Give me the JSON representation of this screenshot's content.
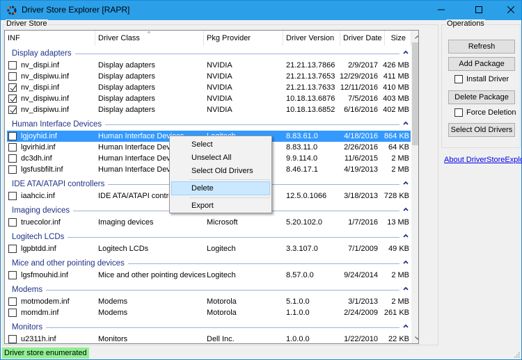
{
  "window": {
    "title": "Driver Store Explorer [RAPR]",
    "icon": "gear-icon",
    "controls": {
      "minimize": "minimize-icon",
      "maximize": "maximize-icon",
      "close": "close-icon"
    }
  },
  "driver_store": {
    "group_label": "Driver Store",
    "columns": [
      {
        "key": "inf",
        "label": "INF"
      },
      {
        "key": "class",
        "label": "Driver Class",
        "sorted": "ascending"
      },
      {
        "key": "provider",
        "label": "Pkg Provider"
      },
      {
        "key": "version",
        "label": "Driver Version"
      },
      {
        "key": "date",
        "label": "Driver Date"
      },
      {
        "key": "size",
        "label": "Size"
      }
    ],
    "groups": [
      {
        "title": "Display adapters",
        "rows": [
          {
            "checked": false,
            "selected": false,
            "inf": "nv_dispi.inf",
            "class": "Display adapters",
            "provider": "NVIDIA",
            "version": "21.21.13.7866",
            "date": "2/9/2017",
            "size": "426 MB"
          },
          {
            "checked": false,
            "selected": false,
            "inf": "nv_dispiwu.inf",
            "class": "Display adapters",
            "provider": "NVIDIA",
            "version": "21.21.13.7653",
            "date": "12/29/2016",
            "size": "411 MB"
          },
          {
            "checked": true,
            "selected": false,
            "inf": "nv_dispi.inf",
            "class": "Display adapters",
            "provider": "NVIDIA",
            "version": "21.21.13.7633",
            "date": "12/11/2016",
            "size": "410 MB"
          },
          {
            "checked": true,
            "selected": false,
            "inf": "nv_dispiwu.inf",
            "class": "Display adapters",
            "provider": "NVIDIA",
            "version": "10.18.13.6876",
            "date": "7/5/2016",
            "size": "403 MB"
          },
          {
            "checked": true,
            "selected": false,
            "inf": "nv_dispiwu.inf",
            "class": "Display adapters",
            "provider": "NVIDIA",
            "version": "10.18.13.6852",
            "date": "6/16/2016",
            "size": "402 MB"
          }
        ]
      },
      {
        "title": "Human Interface Devices",
        "rows": [
          {
            "checked": false,
            "selected": true,
            "inf": "lgjoyhid.inf",
            "class": "Human Interface Devices",
            "provider": "Logitech",
            "version": "8.83.61.0",
            "date": "4/18/2016",
            "size": "864 KB"
          },
          {
            "checked": false,
            "selected": false,
            "inf": "lgvirhid.inf",
            "class": "Human Interface Devices",
            "provider": "",
            "version": "8.83.11.0",
            "date": "2/26/2016",
            "size": "64 KB"
          },
          {
            "checked": false,
            "selected": false,
            "inf": "dc3dh.inf",
            "class": "Human Interface Devices",
            "provider": "",
            "version": "9.9.114.0",
            "date": "11/6/2015",
            "size": "2 MB"
          },
          {
            "checked": false,
            "selected": false,
            "inf": "lgsfusbfilt.inf",
            "class": "Human Interface Devices",
            "provider": "",
            "version": "8.46.17.1",
            "date": "4/19/2013",
            "size": "2 MB"
          }
        ]
      },
      {
        "title": "IDE ATA/ATAPI controllers",
        "rows": [
          {
            "checked": false,
            "selected": false,
            "inf": "iaahcic.inf",
            "class": "IDE ATA/ATAPI controllers",
            "provider": "",
            "version": "12.5.0.1066",
            "date": "3/18/2013",
            "size": "728 KB"
          }
        ]
      },
      {
        "title": "Imaging devices",
        "rows": [
          {
            "checked": false,
            "selected": false,
            "inf": "truecolor.inf",
            "class": "Imaging devices",
            "provider": "Microsoft",
            "version": "5.20.102.0",
            "date": "1/7/2016",
            "size": "13 MB"
          }
        ]
      },
      {
        "title": "Logitech LCDs",
        "rows": [
          {
            "checked": false,
            "selected": false,
            "inf": "lgpbtdd.inf",
            "class": "Logitech LCDs",
            "provider": "Logitech",
            "version": "3.3.107.0",
            "date": "7/1/2009",
            "size": "49 KB"
          }
        ]
      },
      {
        "title": "Mice and other pointing devices",
        "rows": [
          {
            "checked": false,
            "selected": false,
            "inf": "lgsfmouhid.inf",
            "class": "Mice and other pointing devices",
            "provider": "Logitech",
            "version": "8.57.0.0",
            "date": "9/24/2014",
            "size": "2 MB"
          }
        ]
      },
      {
        "title": "Modems",
        "rows": [
          {
            "checked": false,
            "selected": false,
            "inf": "motmodem.inf",
            "class": "Modems",
            "provider": "Motorola",
            "version": "5.1.0.0",
            "date": "3/1/2013",
            "size": "2 MB"
          },
          {
            "checked": false,
            "selected": false,
            "inf": "momdm.inf",
            "class": "Modems",
            "provider": "Motorola",
            "version": "1.1.0.0",
            "date": "2/24/2009",
            "size": "261 KB"
          }
        ]
      },
      {
        "title": "Monitors",
        "rows": [
          {
            "checked": false,
            "selected": false,
            "inf": "u2311h.inf",
            "class": "Monitors",
            "provider": "Dell Inc.",
            "version": "1.0.0.0",
            "date": "1/22/2010",
            "size": "22 KB"
          }
        ]
      }
    ]
  },
  "operations": {
    "group_label": "Operations",
    "refresh_label": "Refresh",
    "add_package_label": "Add Package",
    "install_driver_label": "Install Driver",
    "install_driver_checked": false,
    "delete_package_label": "Delete Package",
    "force_deletion_label": "Force Deletion",
    "force_deletion_checked": false,
    "select_old_drivers_label": "Select Old Drivers",
    "about_link": "About DriverStoreExplorer"
  },
  "context_menu": {
    "items": [
      {
        "label": "Select",
        "highlighted": false
      },
      {
        "label": "Unselect All",
        "highlighted": false
      },
      {
        "label": "Select Old Drivers",
        "highlighted": false
      },
      {
        "label": "Delete",
        "highlighted": true
      },
      {
        "label": "Export",
        "highlighted": false
      }
    ]
  },
  "status": {
    "text": "Driver store enumerated",
    "color": "#90ee90"
  },
  "colors": {
    "titlebar": "#2b9fe8",
    "group_header": "#1e3287",
    "selection": "#3399ff",
    "menu_highlight": "#cce8ff"
  }
}
